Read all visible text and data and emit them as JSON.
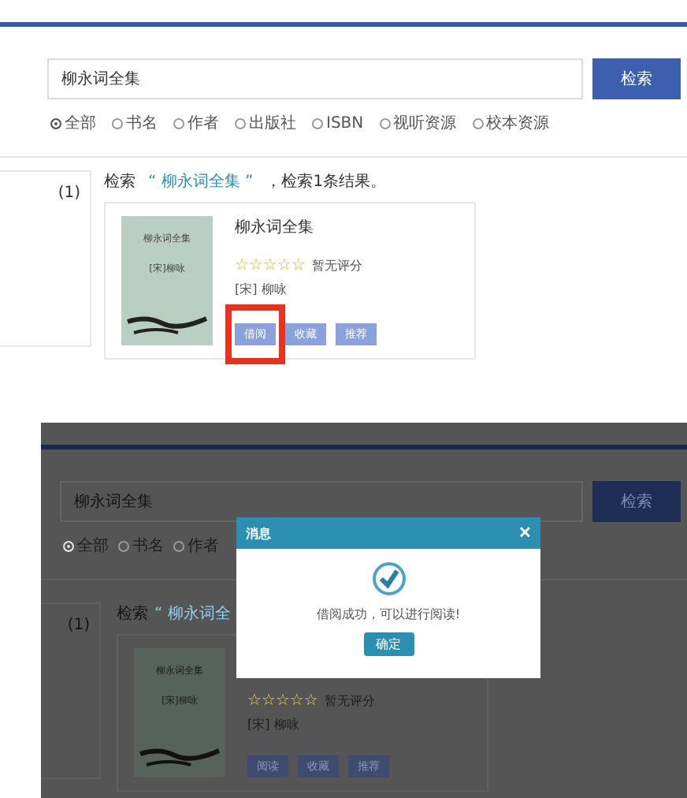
{
  "panels": [
    {
      "dimmed": false,
      "search": {
        "value": "柳永词全集",
        "button": "检索"
      },
      "filters": [
        {
          "label": "全部",
          "selected": true
        },
        {
          "label": "书名",
          "selected": false
        },
        {
          "label": "作者",
          "selected": false
        },
        {
          "label": "出版社",
          "selected": false
        },
        {
          "label": "ISBN",
          "selected": false
        },
        {
          "label": "视听资源",
          "selected": false
        },
        {
          "label": "校本资源",
          "selected": false
        }
      ],
      "sidebar": {
        "count": "(1)"
      },
      "results": {
        "prefix": "检索",
        "query": "“ 柳永词全集 ”",
        "suffix": "，检索1条结果。"
      },
      "book": {
        "cover": {
          "title": "柳永词全集",
          "author": "[宋]柳咏"
        },
        "title": "柳永词全集",
        "stars": 0,
        "rating": "暂无评分",
        "author": "[宋] 柳咏",
        "buttons": [
          {
            "label": "借阅",
            "highlighted": true
          },
          {
            "label": "收藏",
            "highlighted": false
          },
          {
            "label": "推荐",
            "highlighted": false
          }
        ]
      }
    },
    {
      "dimmed": true,
      "search": {
        "value": "柳永词全集",
        "button": "检索"
      },
      "filters": [
        {
          "label": "全部",
          "selected": true
        },
        {
          "label": "书名",
          "selected": false
        },
        {
          "label": "作者",
          "selected": false
        }
      ],
      "sidebar": {
        "count": "(1)"
      },
      "results": {
        "prefix": "检索",
        "query": "“ 柳永词全"
      },
      "book": {
        "cover": {
          "title": "柳永词全集",
          "author": "[宋]柳咏"
        },
        "stars": 0,
        "rating": "暂无评分",
        "author": "[宋] 柳咏",
        "buttons": [
          {
            "label": "阅读",
            "highlighted": false
          },
          {
            "label": "收藏",
            "highlighted": false
          },
          {
            "label": "推荐",
            "highlighted": false
          }
        ]
      },
      "dialog": {
        "title": "消息",
        "close": "✕",
        "message": "借阅成功，可以进行阅读!",
        "button": "确定"
      }
    }
  ]
}
